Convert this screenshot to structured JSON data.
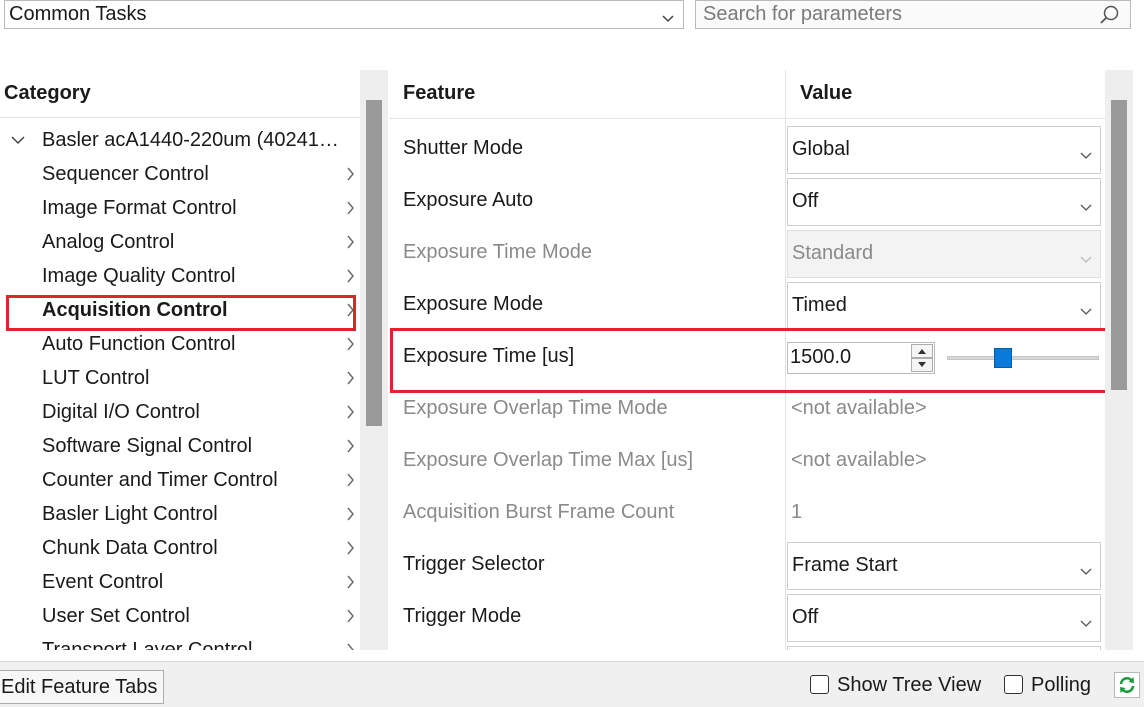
{
  "toolbar": {
    "view_select": "Common Tasks",
    "search_placeholder": "Search for parameters"
  },
  "category": {
    "header": "Category",
    "root": "Basler acA1440-220um (40241…",
    "items": [
      "Sequencer Control",
      "Image Format Control",
      "Analog Control",
      "Image Quality Control",
      "Acquisition Control",
      "Auto Function Control",
      "LUT Control",
      "Digital I/O Control",
      "Software Signal Control",
      "Counter and Timer Control",
      "Basler Light Control",
      "Chunk Data Control",
      "Event Control",
      "User Set Control",
      "Transport Layer Control"
    ],
    "selected": "Acquisition Control"
  },
  "grid": {
    "feature_header": "Feature",
    "value_header": "Value",
    "rows": [
      {
        "feature": "Shutter Mode",
        "value": "Global"
      },
      {
        "feature": "Exposure Auto",
        "value": "Off"
      },
      {
        "feature": "Exposure Time Mode",
        "value": "Standard"
      },
      {
        "feature": "Exposure Mode",
        "value": "Timed"
      },
      {
        "feature": "Exposure Time [us]",
        "value": "1500.0"
      },
      {
        "feature": "Exposure Overlap Time Mode",
        "value": "<not available>"
      },
      {
        "feature": "Exposure Overlap Time Max [us]",
        "value": "<not available>"
      },
      {
        "feature": "Acquisition Burst Frame Count",
        "value": "1"
      },
      {
        "feature": "Trigger Selector",
        "value": "Frame Start"
      },
      {
        "feature": "Trigger Mode",
        "value": "Off"
      }
    ],
    "exposure_slider_fraction": 0.35
  },
  "footer": {
    "edit_tabs": "Edit Feature Tabs",
    "show_tree": "Show Tree View",
    "polling": "Polling"
  },
  "colors": {
    "highlight_red": "#e0242d",
    "slider_blue": "#0a7ad8",
    "refresh_green": "#1a9a3a"
  }
}
